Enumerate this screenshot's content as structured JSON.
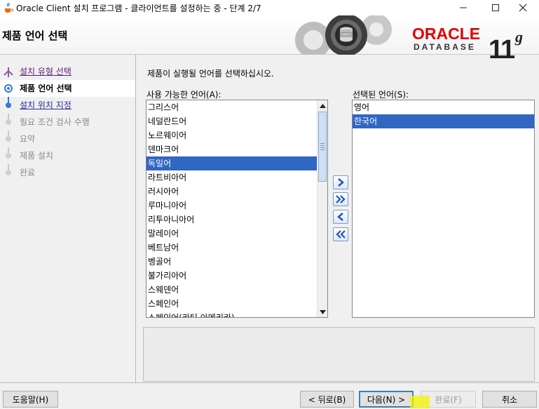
{
  "window": {
    "title": "Oracle Client 설치 프로그램 - 클라이언트를 설정하는 중 - 단계 2/7",
    "controls": [
      "minimize",
      "maximize",
      "close"
    ]
  },
  "banner": {
    "page_title": "제품 언어 선택",
    "logo_oracle": "ORACLE",
    "logo_database": "DATABASE",
    "logo_version": "11",
    "logo_version_suffix": "g",
    "accent_color": "#e30000"
  },
  "steps": [
    {
      "label": "설치 유형 선택",
      "state": "done"
    },
    {
      "label": "제품 언어 선택",
      "state": "current"
    },
    {
      "label": "설치 위치 지정",
      "state": "link"
    },
    {
      "label": "필요 조건 검사 수행",
      "state": "disabled"
    },
    {
      "label": "요약",
      "state": "disabled"
    },
    {
      "label": "제품 설치",
      "state": "disabled"
    },
    {
      "label": "완료",
      "state": "disabled"
    }
  ],
  "content": {
    "instruction": "제품이 실행될 언어를 선택하십시오.",
    "available_label": "사용 가능한 언어(A):",
    "selected_label": "선택된 언어(S):",
    "available_languages": [
      "그리스어",
      "네덜란드어",
      "노르웨이어",
      "덴마크어",
      "독일어",
      "라트비아어",
      "러시아어",
      "루마니아어",
      "리투아니아어",
      "말레이어",
      "베트남어",
      "벵골어",
      "불가리아어",
      "스웨덴어",
      "스페인어",
      "스페인어(라틴 아메리카)"
    ],
    "available_selected": "독일어",
    "selected_languages": [
      "영어",
      "한국어"
    ],
    "selected_selected": "한국어",
    "selection_color": "#3166c3"
  },
  "transfer_buttons": [
    "add-one",
    "add-all",
    "remove-one",
    "remove-all"
  ],
  "buttons": {
    "help": "도움말(H)",
    "back": "< 뒤로(B)",
    "next": "다음(N) >",
    "finish": "완료(F)",
    "cancel": "취소"
  }
}
